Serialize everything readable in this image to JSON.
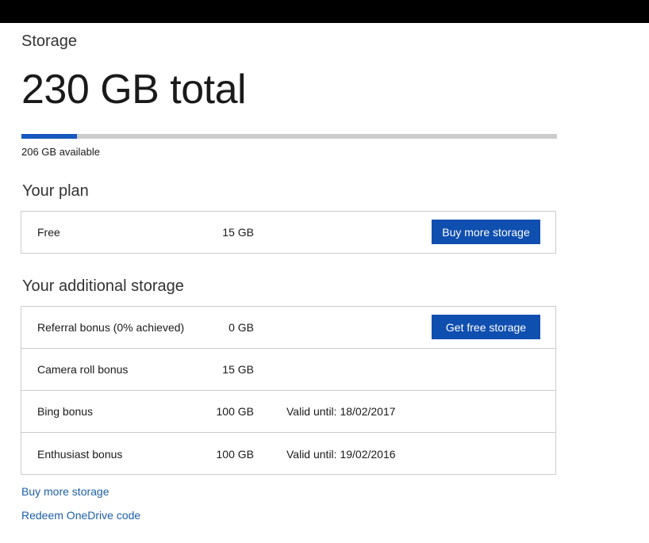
{
  "page": {
    "title": "Storage",
    "total": "230 GB total",
    "available": "206 GB available",
    "usage_fraction": 0.104,
    "accent_color": "#1658bd",
    "track_color": "#cccccc"
  },
  "plan": {
    "heading": "Your plan",
    "row": {
      "name": "Free",
      "size": "15 GB",
      "button_label": "Buy more storage"
    }
  },
  "additional": {
    "heading": "Your additional storage",
    "rows": [
      {
        "name": "Referral bonus (0% achieved)",
        "size": "0 GB",
        "valid": "",
        "button_label": "Get free storage"
      },
      {
        "name": "Camera roll bonus",
        "size": "15 GB",
        "valid": ""
      },
      {
        "name": "Bing bonus",
        "size": "100 GB",
        "valid": "Valid until: 18/02/2017"
      },
      {
        "name": "Enthusiast bonus",
        "size": "100 GB",
        "valid": "Valid until: 19/02/2016"
      }
    ]
  },
  "links": {
    "buy_more": "Buy more storage",
    "redeem": "Redeem OneDrive code"
  }
}
